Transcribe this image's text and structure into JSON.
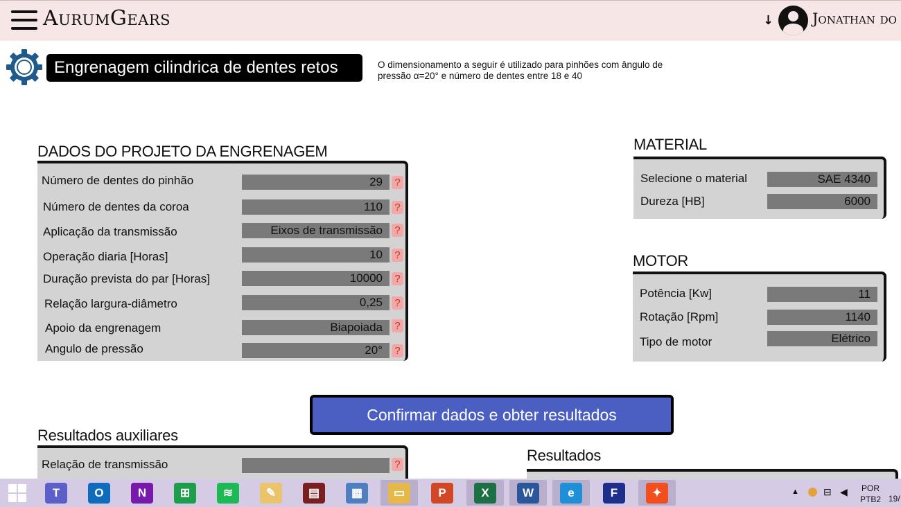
{
  "header": {
    "brand": "AurumGears",
    "user_name": "Jonathan do C"
  },
  "title": {
    "heading": "Engrenagem cilindrica de dentes retos",
    "description": "O dimensionamento a seguir é utilizado para pinhões com ângulo de pressão α=20° e número de dentes entre 18 e 40"
  },
  "design": {
    "section_title": "DADOS DO PROJETO DA ENGRENAGEM",
    "rows": [
      {
        "label": "Número de dentes do pinhão",
        "value": "29"
      },
      {
        "label": "Número de dentes da coroa",
        "value": "110"
      },
      {
        "label": "Aplicação da transmissão",
        "value": "Eixos de transmissão"
      },
      {
        "label": "Operação diaria [Horas]",
        "value": "10"
      },
      {
        "label": "Duração prevista do par [Horas]",
        "value": "10000"
      },
      {
        "label": "Relação largura-diâmetro",
        "value": "0,25"
      },
      {
        "label": "Apoio da engrenagem",
        "value": "Biapoiada"
      },
      {
        "label": "Angulo de pressão",
        "value": "20°"
      }
    ],
    "help_label": "?"
  },
  "material": {
    "section_title": "MATERIAL",
    "rows": [
      {
        "label": "Selecione o material",
        "value": "SAE 4340"
      },
      {
        "label": "Dureza [HB]",
        "value": "6000"
      }
    ]
  },
  "motor": {
    "section_title": "MOTOR",
    "rows": [
      {
        "label": "Potência [Kw]",
        "value": "11"
      },
      {
        "label": "Rotação [Rpm]",
        "value": "1140"
      },
      {
        "label": "Tipo de motor",
        "value": "Elétrico"
      }
    ]
  },
  "confirm_button": "Confirmar dados e obter resultados",
  "aux_results": {
    "section_title": "Resultados auxiliares",
    "rows": [
      {
        "label": "Relação de transmissão",
        "value": ""
      }
    ]
  },
  "results": {
    "section_title": "Resultados"
  },
  "taskbar": {
    "apps": [
      {
        "name": "teams-icon",
        "glyph": "T",
        "color": "#5b5fc7"
      },
      {
        "name": "outlook-icon",
        "glyph": "O",
        "color": "#0f6cbd"
      },
      {
        "name": "onenote-icon",
        "glyph": "N",
        "color": "#7719aa"
      },
      {
        "name": "store-icon",
        "glyph": "⊞",
        "color": "#1e9e4a"
      },
      {
        "name": "spotify-icon",
        "glyph": "≋",
        "color": "#1db954"
      },
      {
        "name": "paint-icon",
        "glyph": "✎",
        "color": "#e9c46a"
      },
      {
        "name": "terminal-icon",
        "glyph": "▤",
        "color": "#7a1f1f"
      },
      {
        "name": "calculator-icon",
        "glyph": "▦",
        "color": "#4f7fbf"
      },
      {
        "name": "file-explorer-icon",
        "glyph": "▭",
        "color": "#e6b84a"
      },
      {
        "name": "powerpoint-icon",
        "glyph": "P",
        "color": "#d24726"
      },
      {
        "name": "excel-icon",
        "glyph": "X",
        "color": "#1d7044"
      },
      {
        "name": "word-icon",
        "glyph": "W",
        "color": "#2b579a"
      },
      {
        "name": "edge-icon",
        "glyph": "e",
        "color": "#1f8fd8"
      },
      {
        "name": "festo-icon",
        "glyph": "F",
        "color": "#1d2f8a"
      },
      {
        "name": "figma-icon",
        "glyph": "✦",
        "color": "#f24e1e"
      }
    ],
    "lang_top": "POR",
    "lang_bottom": "PTB2",
    "clock": "19/"
  }
}
